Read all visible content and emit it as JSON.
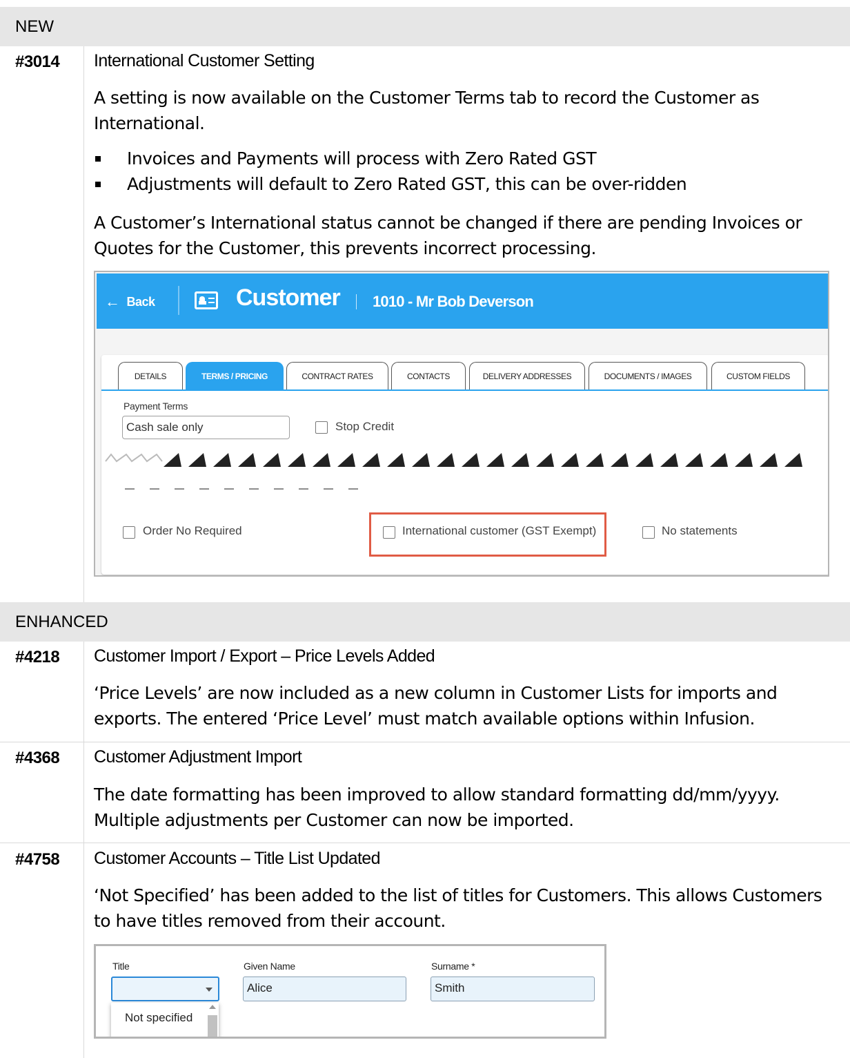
{
  "sections": {
    "new_label": "NEW",
    "enhanced_label": "ENHANCED"
  },
  "item_3014": {
    "number": "#3014",
    "title": "International Customer Setting",
    "intro": "A setting is now available on the Customer Terms tab to record the Customer as International.",
    "bullets": [
      "Invoices and Payments will process with Zero Rated GST",
      "Adjustments will default to Zero Rated GST, this can be over-ridden"
    ],
    "note": "A Customer’s International status cannot be changed if there are pending Invoices or Quotes for the Customer, this prevents incorrect processing."
  },
  "customer_screen": {
    "back_label": "Back",
    "page_title": "Customer",
    "customer_name": "1010 - Mr Bob Deverson",
    "tabs": [
      "DETAILS",
      "TERMS / PRICING",
      "CONTRACT RATES",
      "CONTACTS",
      "DELIVERY ADDRESSES",
      "DOCUMENTS / IMAGES",
      "CUSTOM FIELDS"
    ],
    "active_tab": "TERMS / PRICING",
    "payment_terms_label": "Payment Terms",
    "payment_terms_value": "Cash sale only",
    "stop_credit_label": "Stop Credit",
    "order_no_required_label": "Order No Required",
    "international_customer_label": "International customer (GST Exempt)",
    "no_statements_label": "No statements",
    "highlight_color": "#e05c45",
    "accent_color": "#2aa3ee"
  },
  "item_4218": {
    "number": "#4218",
    "title": "Customer Import / Export – Price Levels Added",
    "body": "‘Price Levels’ are now included as a new column in Customer Lists for imports and exports. The entered ‘Price Level’ must match available options within Infusion."
  },
  "item_4368": {
    "number": "#4368",
    "title": "Customer Adjustment Import",
    "body": "The date formatting has been improved to allow standard formatting dd/mm/yyyy. Multiple adjustments per Customer can now be imported."
  },
  "item_4758": {
    "number": "#4758",
    "title": "Customer Accounts – Title List Updated",
    "body": "‘Not Specified’ has been added to the list of titles for Customers. This allows Customers to have titles removed from their account."
  },
  "title_screen": {
    "title_label": "Title",
    "given_name_label": "Given Name",
    "given_name_value": "Alice",
    "surname_label": "Surname *",
    "surname_value": "Smith",
    "dropdown_option": "Not specified"
  }
}
